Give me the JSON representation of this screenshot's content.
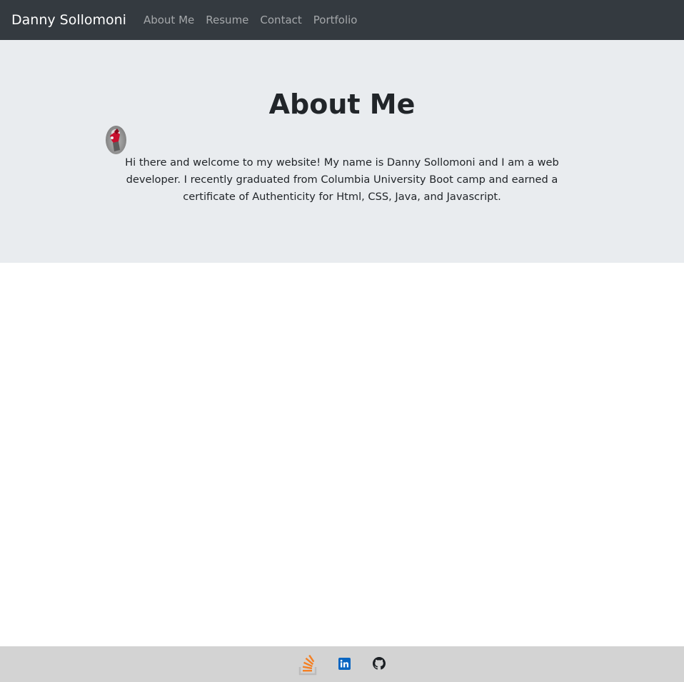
{
  "navbar": {
    "brand": "Danny Sollomoni",
    "links": [
      "About Me",
      "Resume",
      "Contact",
      "Portfolio"
    ]
  },
  "about": {
    "title": "About Me",
    "intro": "Hi there and welcome to my website! My name is Danny Sollomoni and I am a web developer. I recently graduated from Columbia University Boot camp and earned a certificate of Authenticity for Html, CSS, Java, and Javascript."
  },
  "footer": {
    "icons": [
      "stack-overflow-icon",
      "linkedin-icon",
      "github-icon"
    ]
  },
  "colors": {
    "navbar_bg": "#343a40",
    "jumbotron_bg": "#e9ecef",
    "footer_bg": "#d3d3d3",
    "stackoverflow_orange": "#f48024",
    "linkedin_blue": "#0a66c2"
  }
}
